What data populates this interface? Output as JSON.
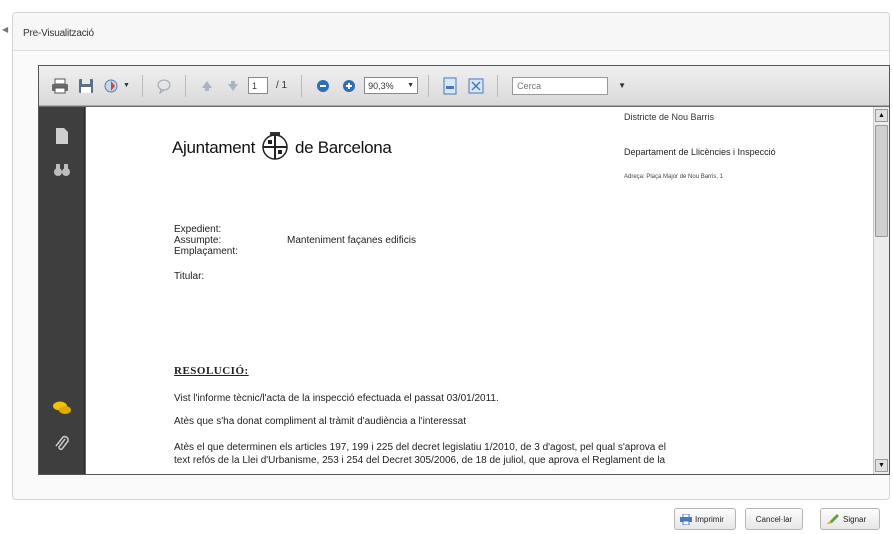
{
  "panel": {
    "title": "Pre-Visualització"
  },
  "toolbar": {
    "page_current": "1",
    "page_total": "/ 1",
    "zoom": "90,3%",
    "search_placeholder": "Cerca"
  },
  "document": {
    "logo_left": "Ajuntament",
    "logo_right": "de Barcelona",
    "district": "Districte de Nou Barris",
    "department": "Departament de Llicències i Inspecció",
    "address": "Adreça: Plaça Major de Nou Barris, 1",
    "fields": [
      {
        "label": "Expedient:",
        "value": ""
      },
      {
        "label": "Assumpte:",
        "value": "Manteniment façanes edificis"
      },
      {
        "label": "Emplaçament:",
        "value": ""
      },
      {
        "label": "Titular:",
        "value": ""
      }
    ],
    "heading": "RESOLUCIÓ:",
    "paragraphs": [
      "Vist l'informe tècnic/l'acta de la inspecció efectuada el passat 03/01/2011.",
      "Atès que s'ha donat compliment al tràmit d'audiència a l'interessat",
      "Atès el que determinen els articles 197, 199 i 225 del decret legislatiu 1/2010, de 3 d'agost, pel qual s'aprova el",
      "text refós de la Llei d'Urbanisme, 253 i 254 del Decret 305/2006, de 18 de juliol, que aprova el Reglament de la"
    ]
  },
  "buttons": {
    "print": "Imprimir",
    "cancel": "Cancel·lar",
    "sign": "Signar"
  },
  "colors": {
    "sidebar": "#3e3e3e",
    "toolbar": "#dcdcdc",
    "accent_blue": "#2f6db5"
  }
}
